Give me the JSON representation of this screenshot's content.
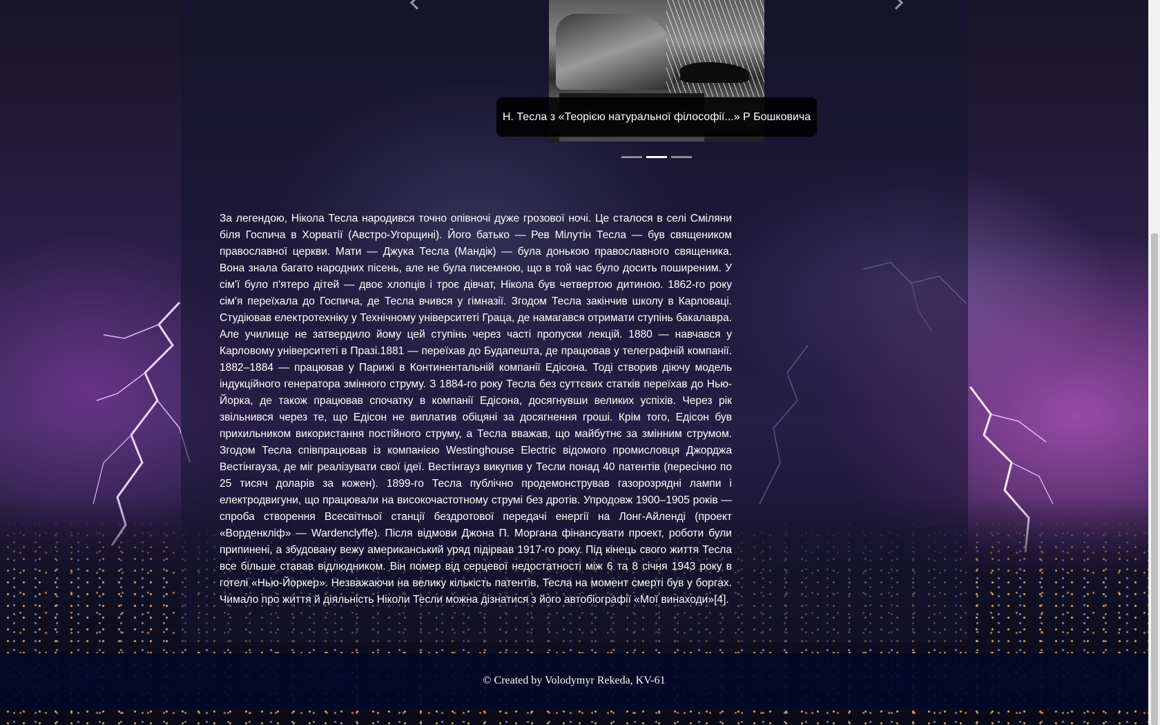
{
  "carousel": {
    "caption": "Н. Тесла з «Теорією натуральної філософії...» Р Бошковича",
    "prev_icon": "chevron-left-icon",
    "next_icon": "chevron-right-icon",
    "slide_count": 3,
    "active_slide": 2
  },
  "biography": {
    "text": "За легендою, Нікола Тесла народився точно опівночі дуже грозової ночі. Це сталося в селі Сміляни біля Госпича в Хорватії (Австро-Угорщині). Його батько — Рев Мілутін Тесла — був священиком православної церкви. Мати — Джука Тесла (Мандік) — була донькою православного священика. Вона знала багато народних пісень, але не була писемною, що в той час було досить поширеним. У сім'ї було п'ятеро дітей — двоє хлопців і троє дівчат, Нікола був четвертою дитиною. 1862-го року сім'я переїхала до Госпича, де Тесла вчився у гімназії. Згодом Тесла закінчив школу в Карловаці. Студіював електротехніку у Технічному університеті Граца, де намагався отримати ступінь бакалавра. Але училище не затвердило йому цей ступінь через часті пропуски лекцій. 1880 — навчався у Карловому університеті в Празі.1881 — переїхав до Будапешта, де працював у телеграфній компанії. 1882–1884 — працював у Парижі в Континентальній компанії Едісона. Тоді створив діючу модель індукційного генератора змінного струму. З 1884-го року Тесла без суттєвих статків переїхав до Нью-Йорка, де також працював спочатку в компанії Едісона, досягнувши великих успіхів. Через рік звільнився через те, що Едісон не виплатив обіцяні за досягнення гроші. Крім того, Едісон був прихильником використання постійного струму, а Тесла вважав, що майбутнє за змінним струмом. Згодом Тесла співпрацював із компанією Westinghouse Electric відомого промисловця Джорджа Вестінгауза, де міг реалізувати свої ідеї. Вестінгауз викупив у Тесли понад 40 патентів (пересічно по 25 тисяч доларів за кожен). 1899-го Тесла публічно продемонстрував газорозрядні лампи і електродвигуни, що працювали на високочастотному струмі без дротів. Упродовж 1900–1905 років — спроба створення Всесвітньої станції бездротової передачі енергії на Лонг-Айленді (проект «Ворденкліф» — Wardenclyffe). Після відмови Джона П. Моргана фінансувати проект, роботи були припинені, а збудовану вежу американський уряд підірвав 1917-го року. Під кінець свого життя Тесла все більше ставав відлюдником. Він помер від серцевої недостатності між 6 та 8 січня 1943 року в готелі «Нью-Йоркер». Незважаючи на велику кількість патентів, Тесла на момент смерті був у боргах. Чимало про життя й діяльність Ніколи Тесли можна дізнатися з його автобіографії «Мої винаходи»[4]."
  },
  "footer": {
    "text": "© Created by Volodymyr Rekeda, KV-61"
  },
  "colors": {
    "footer_bg": "#040826",
    "panel_bg": "#141430",
    "caption_bg": "#000000"
  }
}
